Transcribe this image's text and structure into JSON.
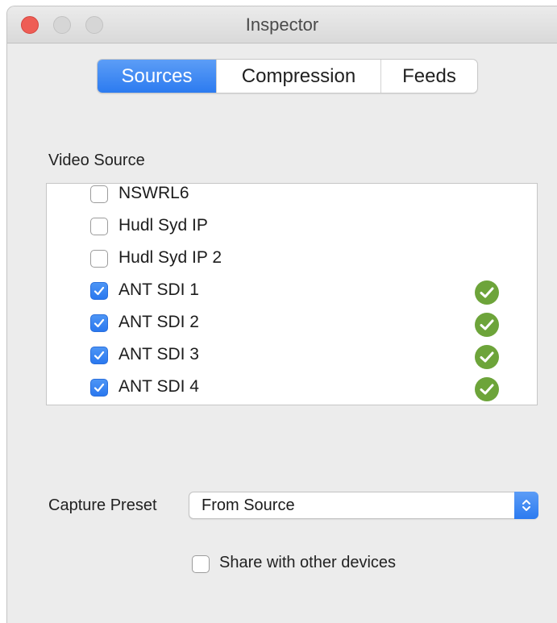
{
  "window": {
    "title": "Inspector",
    "buttons": [
      "close",
      "minimize",
      "maximize"
    ]
  },
  "tabs": [
    {
      "label": "Sources",
      "active": true
    },
    {
      "label": "Compression",
      "active": false
    },
    {
      "label": "Feeds",
      "active": false
    }
  ],
  "video_source": {
    "label": "Video Source",
    "items": [
      {
        "label": "NSWRL6",
        "checked": false,
        "status": ""
      },
      {
        "label": "Hudl Syd IP",
        "checked": false,
        "status": ""
      },
      {
        "label": "Hudl Syd IP 2",
        "checked": false,
        "status": ""
      },
      {
        "label": "ANT SDI 1",
        "checked": true,
        "status": "ok"
      },
      {
        "label": "ANT SDI 2",
        "checked": true,
        "status": "ok"
      },
      {
        "label": "ANT SDI 3",
        "checked": true,
        "status": "ok"
      },
      {
        "label": "ANT SDI 4",
        "checked": true,
        "status": "ok"
      }
    ]
  },
  "capture_preset": {
    "label": "Capture Preset",
    "value": "From Source"
  },
  "share": {
    "label": "Share with other devices",
    "checked": false
  },
  "colors": {
    "accent": "#2c7bf0",
    "ok_green": "#6da43a",
    "close_red": "#ee5d55"
  },
  "icons": {
    "ok": "checkmark-circle-icon",
    "select_stepper": "chevron-up-down-icon"
  }
}
